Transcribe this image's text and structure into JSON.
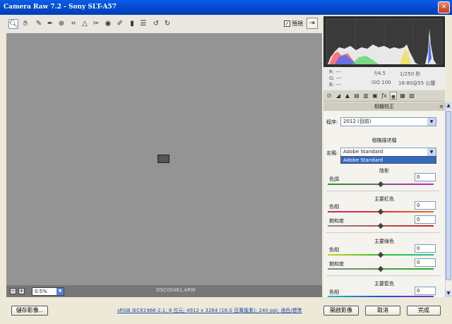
{
  "window": {
    "title": "Camera Raw 7.2  -  Sony SLT-A57",
    "close_icon": "close-icon"
  },
  "toolbar": {
    "tools": [
      "zoom-icon",
      "hand-icon",
      "white-balance-icon",
      "color-sampler-icon",
      "target-adjust-icon",
      "crop-icon",
      "straighten-icon",
      "spot-removal-icon",
      "red-eye-icon",
      "adjustment-brush-icon",
      "graduated-filter-icon",
      "preferences-icon",
      "rotate-left-icon",
      "rotate-right-icon"
    ],
    "preview_checked": "✓",
    "preview_label": "預視"
  },
  "preview": {
    "zoom": "0.5%",
    "filename": "DSC00461.ARW"
  },
  "histogram": {
    "r": "R:  ---",
    "g": "G:  ---",
    "b": "B:  ---",
    "aperture": "f/4.5",
    "shutter": "1/250 秒",
    "iso": "ISO 100",
    "lens": "16-80@55 公釐"
  },
  "panel": {
    "title": "相機校正",
    "process_label": "程序:",
    "process_value": "2012 (目前)",
    "profile_section": "相機描述檔",
    "name_label": "名稱:",
    "name_value": "Adobe Standard",
    "dropdown_option": "Adobe Standard",
    "shadows": {
      "title": "陰影",
      "tint_label": "色調",
      "tint_value": "0"
    },
    "red": {
      "title": "主要紅色",
      "hue_label": "色相",
      "hue_value": "0",
      "sat_label": "飽和度",
      "sat_value": "0"
    },
    "green": {
      "title": "主要綠色",
      "hue_label": "色相",
      "hue_value": "0",
      "sat_label": "飽和度",
      "sat_value": "0"
    },
    "blue": {
      "title": "主要藍色",
      "hue_label": "色相",
      "hue_value": "0"
    }
  },
  "footer": {
    "save_label": "儲存影像...",
    "info_text": "sRGB IEC61966-2.1; 8 位元; 4912 x 3264 (16.0 百萬像素); 240 ppi; 適色/標準",
    "open_label": "開啟影像",
    "cancel_label": "取消",
    "done_label": "完成"
  }
}
